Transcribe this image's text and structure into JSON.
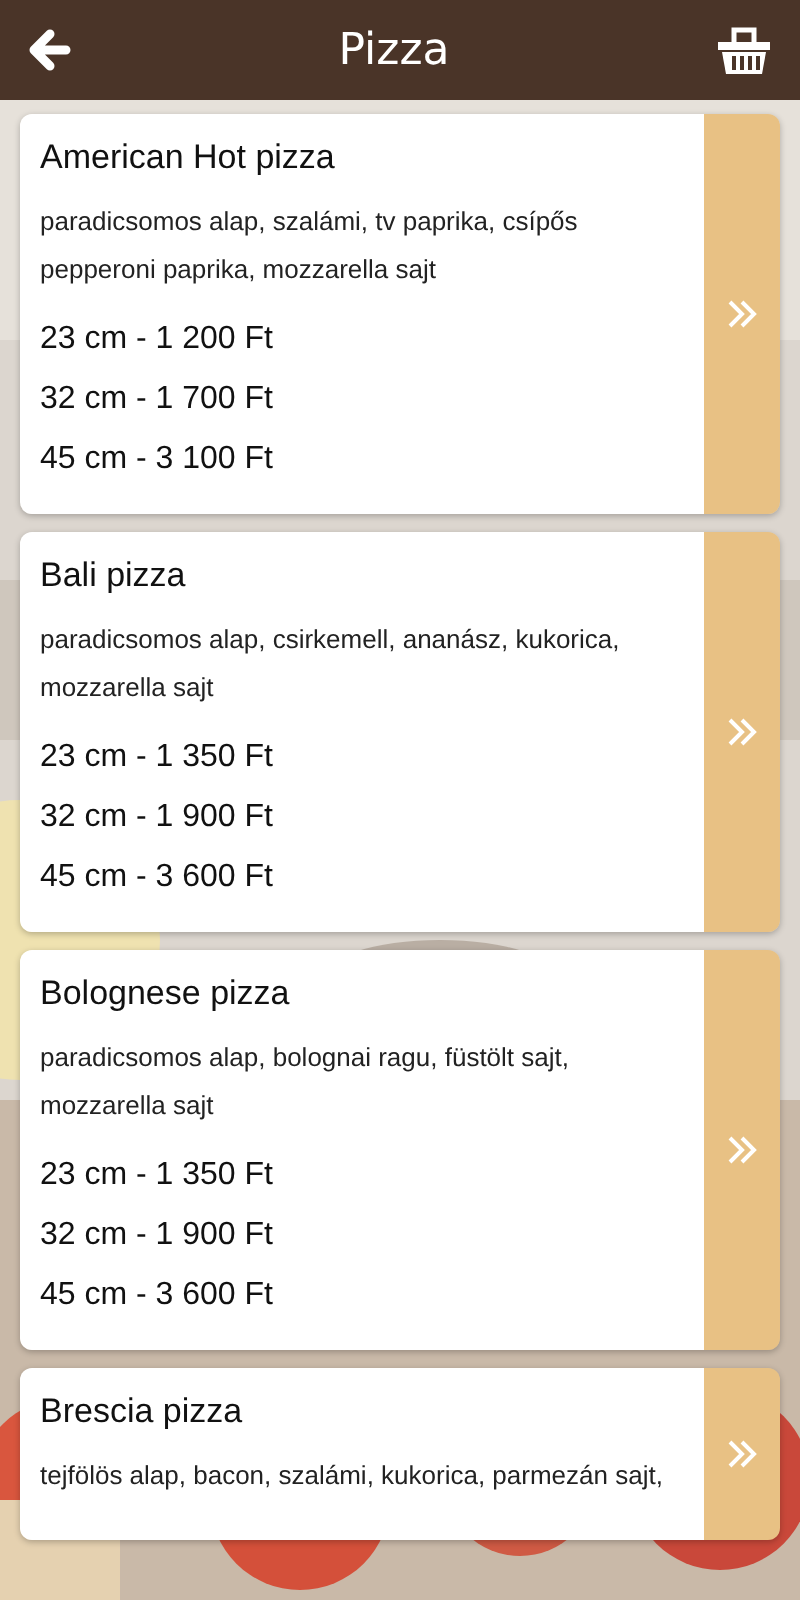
{
  "header": {
    "title": "Pizza"
  },
  "items": [
    {
      "name": "American Hot pizza",
      "description": "paradicsomos alap, szalámi, tv paprika, csípős pepperoni paprika, mozzarella  sajt",
      "prices": [
        "23 cm - 1 200 Ft",
        "32 cm - 1 700 Ft",
        "45 cm - 3 100 Ft"
      ]
    },
    {
      "name": "Bali pizza",
      "description": "paradicsomos alap, csirkemell, ananász, kukorica, mozzarella  sajt",
      "prices": [
        "23 cm - 1 350 Ft",
        "32 cm - 1 900 Ft",
        "45 cm - 3 600 Ft"
      ]
    },
    {
      "name": "Bolognese pizza",
      "description": "paradicsomos alap, bolognai ragu, füstölt sajt, mozzarella  sajt",
      "prices": [
        "23 cm - 1 350 Ft",
        "32 cm - 1 900 Ft",
        "45 cm - 3 600 Ft"
      ]
    },
    {
      "name": "Brescia pizza",
      "description": "tejfölös alap, bacon, szalámi, kukorica, parmezán sajt,"
    }
  ]
}
